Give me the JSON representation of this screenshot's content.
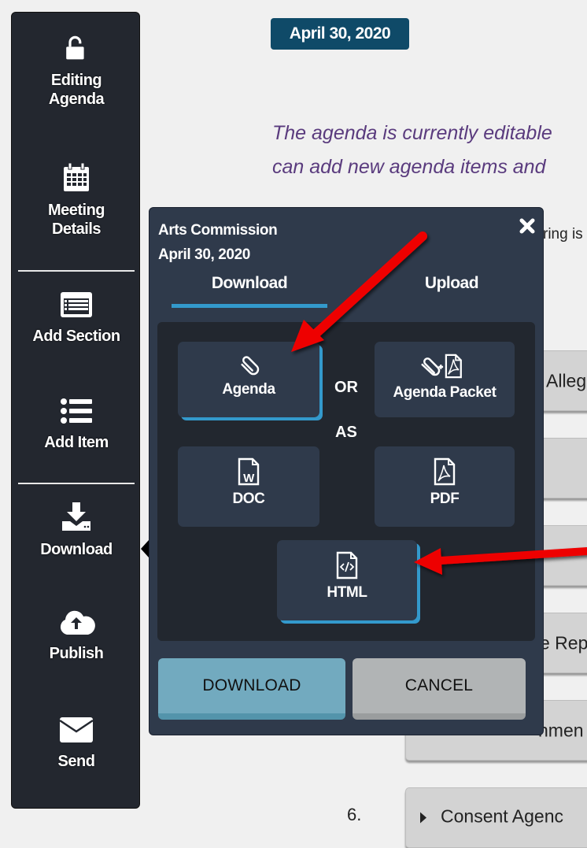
{
  "sidebar": {
    "items": [
      {
        "label_line1": "Editing",
        "label_line2": "Agenda",
        "icon": "unlock-icon"
      },
      {
        "label_line1": "Meeting",
        "label_line2": "Details",
        "icon": "calendar-icon"
      },
      {
        "label": "Add Section",
        "icon": "section-list-icon"
      },
      {
        "label": "Add Item",
        "icon": "list-icon"
      },
      {
        "label": "Download",
        "icon": "download-icon"
      },
      {
        "label": "Publish",
        "icon": "cloud-upload-icon"
      },
      {
        "label": "Send",
        "icon": "envelope-icon"
      }
    ]
  },
  "page": {
    "date_badge": "April 30, 2020",
    "intro_line1": "The agenda is currently editable",
    "intro_line2": "can add new agenda items and",
    "note_fragment": "ring is",
    "agenda_items": [
      {
        "text": "Alleg"
      },
      {
        "text": ""
      },
      {
        "text": ""
      },
      {
        "text": "e Rep"
      },
      {
        "text": "nmen"
      },
      {
        "number": "6.",
        "text": "Consent Agenc"
      }
    ]
  },
  "modal": {
    "title_line1": "Arts Commission",
    "title_line2": "April 30, 2020",
    "close_icon": "close-icon",
    "tabs": [
      {
        "label": "Download",
        "active": true
      },
      {
        "label": "Upload",
        "active": false
      }
    ],
    "content_options": [
      {
        "label": "Agenda",
        "icon": "paperclip-icon",
        "selected": true
      },
      {
        "label": "Agenda Packet",
        "icon": "paperclip-plus-pdf-icon",
        "selected": false
      }
    ],
    "separator_or": "OR",
    "separator_as": "AS",
    "format_options": [
      {
        "label": "DOC",
        "icon": "word-file-icon",
        "selected": false
      },
      {
        "label": "PDF",
        "icon": "pdf-file-icon",
        "selected": false
      },
      {
        "label": "HTML",
        "icon": "html-file-icon",
        "selected": true
      }
    ],
    "download_button": "DOWNLOAD",
    "cancel_button": "CANCEL"
  },
  "annotations": {
    "arrow_color": "#ee0000"
  },
  "colors": {
    "sidebar_bg": "#23272f",
    "modal_bg": "#2f3a4b",
    "panel_bg": "#22272f",
    "accent": "#3399cc",
    "date_badge_bg": "#0f4a68",
    "intro_text": "#5a3b7e",
    "download_btn": "#72aabf",
    "cancel_btn": "#b1b4b5"
  }
}
